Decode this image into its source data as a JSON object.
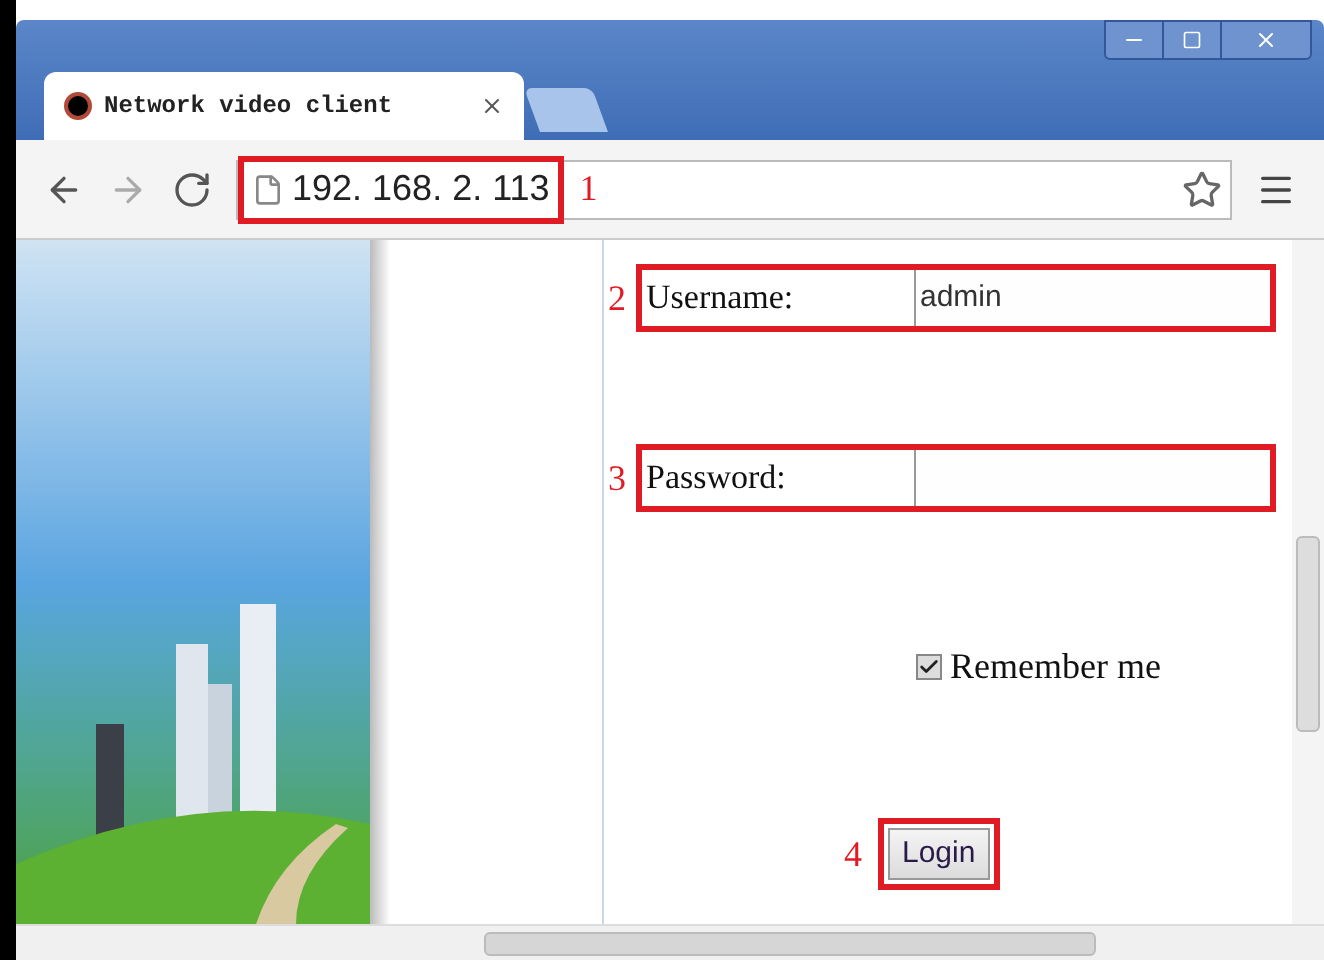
{
  "window": {
    "tab": {
      "title": "Network video client"
    },
    "address": "192. 168. 2. 113",
    "annotation": "1"
  },
  "form": {
    "fields": [
      {
        "label": "Username:",
        "value": "admin",
        "annotation": "2"
      },
      {
        "label": "Password:",
        "annotation": "3"
      }
    ],
    "remember": {
      "label": "Remember me",
      "checked": true
    },
    "login": {
      "label": "Login",
      "annotation": "4"
    }
  }
}
